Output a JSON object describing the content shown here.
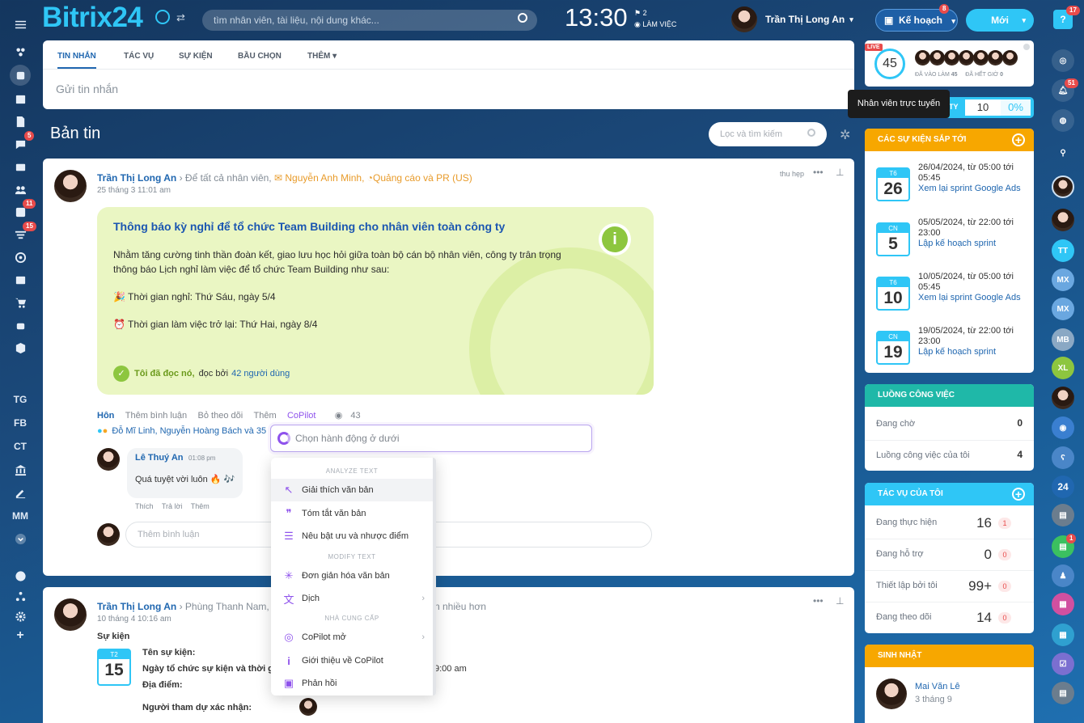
{
  "header": {
    "logo": "Bitrix24",
    "search_placeholder": "tìm nhân viên, tài liệu, nội dung khác...",
    "clock": "13:30",
    "flag_count": "2",
    "work_status": "LÀM VIỆC",
    "user_name": "Trần Thị Long An",
    "plan_label": "Kế hoạch",
    "plan_badge": "8",
    "new_label": "Mới",
    "help_badge": "17"
  },
  "leftbar": {
    "items": [
      {
        "icon": "grid-icon"
      },
      {
        "icon": "feed-icon"
      },
      {
        "icon": "calendar-icon"
      },
      {
        "icon": "document-icon"
      },
      {
        "icon": "chat-icon",
        "badge": "5"
      },
      {
        "icon": "mail-icon"
      },
      {
        "icon": "group-icon"
      },
      {
        "icon": "task-icon",
        "badge": "11"
      },
      {
        "icon": "filter-icon",
        "badge": "15"
      },
      {
        "icon": "target-icon"
      },
      {
        "icon": "contact-card-icon"
      },
      {
        "icon": "cart-icon"
      },
      {
        "icon": "robot-icon"
      },
      {
        "icon": "box-icon"
      },
      {
        "label": "TG"
      },
      {
        "label": "FB"
      },
      {
        "label": "CT"
      },
      {
        "icon": "bank-icon"
      },
      {
        "icon": "sign-icon"
      },
      {
        "label": "MM"
      },
      {
        "icon": "chevron-down-icon"
      },
      {
        "icon": "help-icon"
      },
      {
        "icon": "sitemap-icon"
      },
      {
        "icon": "gear-icon"
      },
      {
        "icon": "plus-icon"
      }
    ]
  },
  "composer": {
    "tabs": [
      "TIN NHẮN",
      "TÁC VỤ",
      "SỰ KIỆN",
      "BẦU CHỌN",
      "THÊM"
    ],
    "placeholder": "Gửi tin nhắn"
  },
  "feed": {
    "title": "Bản tin",
    "search_placeholder": "Lọc và tìm kiếm"
  },
  "post1": {
    "author": "Trần Thị Long An",
    "to": "Để tất cả nhân viên,",
    "to2": "Nguyễn Anh Minh,",
    "to3": "Quảng cáo và PR (US)",
    "date": "25 tháng 3 11:01 am",
    "collapse": "thu hẹp",
    "notice_title": "Thông báo kỳ nghỉ để tổ chức Team Building cho nhân viên toàn công ty",
    "line1": "Nhằm tăng cường tinh thần đoàn kết, giao lưu học hỏi giữa toàn bộ cán bộ nhân viên, công ty trân trọng",
    "line2": "thông báo Lịch nghỉ làm việc để tổ chức Team Building như sau:",
    "line3": "🎉 Thời gian nghỉ: Thứ Sáu, ngày 5/4",
    "line4": "⏰ Thời gian làm việc trở lại: Thứ Hai, ngày 8/4",
    "read_label": "Tôi đã đọc nó,",
    "read_by": "đọc bởi",
    "read_count": "42 người dùng",
    "actions": [
      "Hôn",
      "Thêm bình luận",
      "Bỏ theo dõi",
      "Thêm",
      "CoPilot"
    ],
    "views": "43",
    "reactions": "Đỗ Mĩ Linh, Nguyễn Hoàng Bách và 35",
    "comment_author": "Lê Thuý An",
    "comment_time": "01:08 pm",
    "comment_text": "Quá tuyệt vời luôn 🔥 🎶",
    "comment_actions": [
      "Thích",
      "Trả lời",
      "Thêm"
    ],
    "comment_placeholder": "Thêm bình luận"
  },
  "copilot": {
    "input_placeholder": "Chọn hành động ở dưới",
    "sections": [
      "ANALYZE TEXT",
      "MODIFY TEXT",
      "NHÀ CUNG CẤP"
    ],
    "items": [
      {
        "label": "Giải thích văn bản",
        "icon": "cursor-icon"
      },
      {
        "label": "Tóm tắt văn bản",
        "icon": "quote-icon"
      },
      {
        "label": "Nêu bật ưu và nhược điểm",
        "icon": "sliders-icon"
      },
      {
        "label": "Đơn giản hóa văn bản",
        "icon": "sparkle-icon"
      },
      {
        "label": "Dịch",
        "icon": "translate-icon"
      },
      {
        "label": "CoPilot mở",
        "icon": "copilot-icon"
      },
      {
        "label": "Giới thiệu về CoPilot",
        "icon": "info-icon"
      },
      {
        "label": "Phản hồi",
        "icon": "feedback-icon"
      }
    ]
  },
  "post2": {
    "author": "Trần Thị Long An",
    "to": "Phùng Thanh Nam,",
    "more": "n nhiều hơn",
    "date": "10 tháng 4 10:16 am",
    "type": "Sự kiện",
    "cal_day": "T2",
    "cal_num": "15",
    "f1": "Tên sự kiện:",
    "f2": "Ngày tổ chức sự kiện và thời g",
    "f2v": "9:00 am",
    "f3": "Địa điểm:",
    "f4": "Người tham dự xác nhận:"
  },
  "online": {
    "count": "45",
    "live": "LIVE",
    "in_label": "ĐÃ VÀO LÀM",
    "in_count": "45",
    "out_label": "ĐÃ HẾT GIỜ",
    "out_count": "0",
    "tooltip": "Nhân viên trực tuyến",
    "eff_value": "10",
    "eff_pct": "0%",
    "eff_label": "TY"
  },
  "events": {
    "title": "CÁC SỰ KIỆN SẮP TỚI",
    "items": [
      {
        "day": "T6",
        "num": "26",
        "time": "26/04/2024, từ 05:00 tới 05:45",
        "name": "Xem lại sprint Google Ads"
      },
      {
        "day": "CN",
        "num": "5",
        "time": "05/05/2024, từ 22:00 tới 23:00",
        "name": "Lập kế hoạch sprint"
      },
      {
        "day": "T6",
        "num": "10",
        "time": "10/05/2024, từ 05:00 tới 05:45",
        "name": "Xem lại sprint Google Ads"
      },
      {
        "day": "CN",
        "num": "19",
        "time": "19/05/2024, từ 22:00 tới 23:00",
        "name": "Lập kế hoạch sprint"
      }
    ]
  },
  "workflow": {
    "title": "LUỒNG CÔNG VIỆC",
    "rows": [
      {
        "label": "Đang chờ",
        "value": "0"
      },
      {
        "label": "Luồng công việc của tôi",
        "value": "4"
      }
    ]
  },
  "tasks": {
    "title": "TÁC VỤ CỦA TÔI",
    "rows": [
      {
        "label": "Đang thực hiện",
        "value": "16",
        "badge": "1"
      },
      {
        "label": "Đang hỗ trợ",
        "value": "0",
        "badge": "0"
      },
      {
        "label": "Thiết lập bởi tôi",
        "value": "99+",
        "badge": "0"
      },
      {
        "label": "Đang theo dõi",
        "value": "14",
        "badge": "0"
      }
    ]
  },
  "birthday": {
    "title": "SINH NHẬT",
    "name": "Mai Văn Lê",
    "date": "3 tháng 9"
  },
  "rightrail": {
    "items": [
      {
        "label": "TT"
      },
      {
        "label": "MX"
      },
      {
        "label": "MX"
      },
      {
        "label": "MB"
      },
      {
        "label": "XL"
      },
      {
        "label": "24"
      }
    ],
    "badge1": "51",
    "badge2": "1"
  }
}
